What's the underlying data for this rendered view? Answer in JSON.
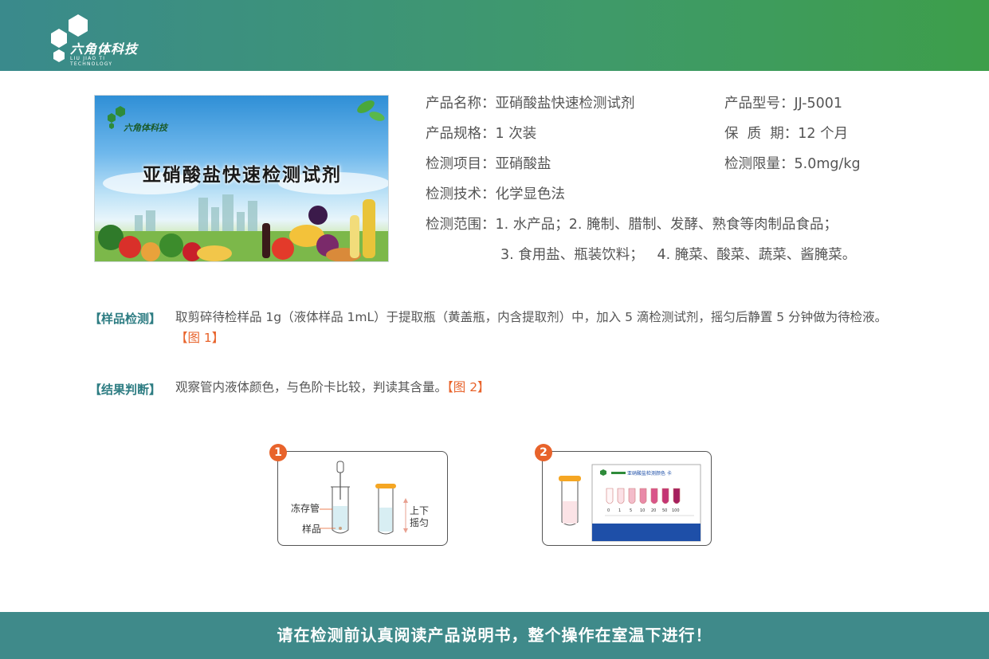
{
  "header": {
    "company_name": "六角体科技",
    "company_sub": "LIU JIAO TI TECHNOLOGY"
  },
  "banner": {
    "title": "亚硝酸盐快速检测试剂",
    "brand": "六角体科技"
  },
  "specs": {
    "name": "产品名称：亚硝酸盐快速检测试剂",
    "model": "产品型号：JJ-5001",
    "size": "产品规格：1 次装",
    "shelf": "保  质  期：12 个月",
    "item": "检测项目：亚硝酸盐",
    "limit": "检测限量：5.0mg/kg",
    "tech": "检测技术：化学显色法",
    "scope1": "检测范围：1. 水产品；2. 腌制、腊制、发酵、熟食等肉制品食品；",
    "scope2": "3. 食用盐、瓶装饮料；   4. 腌菜、酸菜、蔬菜、酱腌菜。"
  },
  "sections": {
    "sample_label": "【样品检测】",
    "sample_text": "取剪碎待检样品 1g（液体样品 1mL）于提取瓶（黄盖瓶，内含提取剂）中，加入 5 滴检测试剂，摇匀后静置 5 分钟做为待检液。",
    "sample_ref": "【图 1】",
    "result_label": "【结果判断】",
    "result_text": "观察管内液体颜色，与色阶卡比较，判读其含量。",
    "result_ref": "【图 2】"
  },
  "figures": {
    "fig1_num": "1",
    "fig1_tube_label": "冻存管",
    "fig1_sample_label": "样品",
    "fig1_shake_label1": "上下",
    "fig1_shake_label2": "摇匀",
    "fig2_num": "2",
    "fig2_card_title": "亚硝酸盐检测颜色  卡",
    "fig2_scale": [
      "0",
      "1",
      "5",
      "10",
      "20",
      "50",
      "100"
    ]
  },
  "footer": {
    "text": "请在检测前认真阅读产品说明书，整个操作在室温下进行！"
  },
  "colors": {
    "header_start": "#3a8a8c",
    "header_end": "#3d9e4a",
    "accent": "#e8632b",
    "label": "#2e7d83",
    "footer": "#3f8a8a"
  }
}
